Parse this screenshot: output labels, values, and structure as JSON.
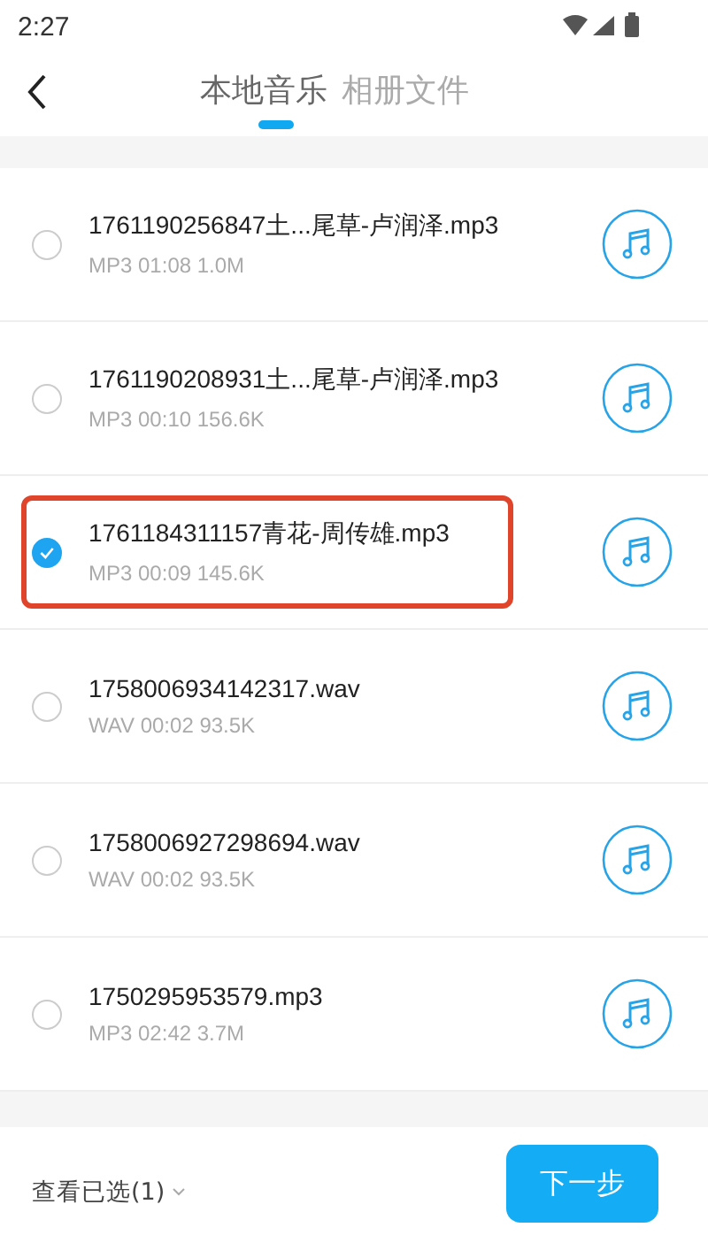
{
  "status_bar": {
    "time": "2:27"
  },
  "tabs": [
    {
      "label": "本地音乐",
      "selected": true
    },
    {
      "label": "相册文件",
      "selected": false
    }
  ],
  "files": [
    {
      "name": "1761190256847土...尾草-卢润泽.mp3",
      "info": "MP3 01:08 1.0M",
      "selected": false
    },
    {
      "name": "1761190208931土...尾草-卢润泽.mp3",
      "info": "MP3 00:10 156.6K",
      "selected": false
    },
    {
      "name": "1761184311157青花-周传雄.mp3",
      "info": "MP3 00:09 145.6K",
      "selected": true
    },
    {
      "name": "1758006934142317.wav",
      "info": "WAV 00:02 93.5K",
      "selected": false
    },
    {
      "name": "1758006927298694.wav",
      "info": "WAV 00:02 93.5K",
      "selected": false
    },
    {
      "name": "1750295953579.mp3",
      "info": "MP3 02:42 3.7M",
      "selected": false
    }
  ],
  "footer": {
    "view_selected": "查看已选(1)",
    "next_button": "下一步"
  }
}
